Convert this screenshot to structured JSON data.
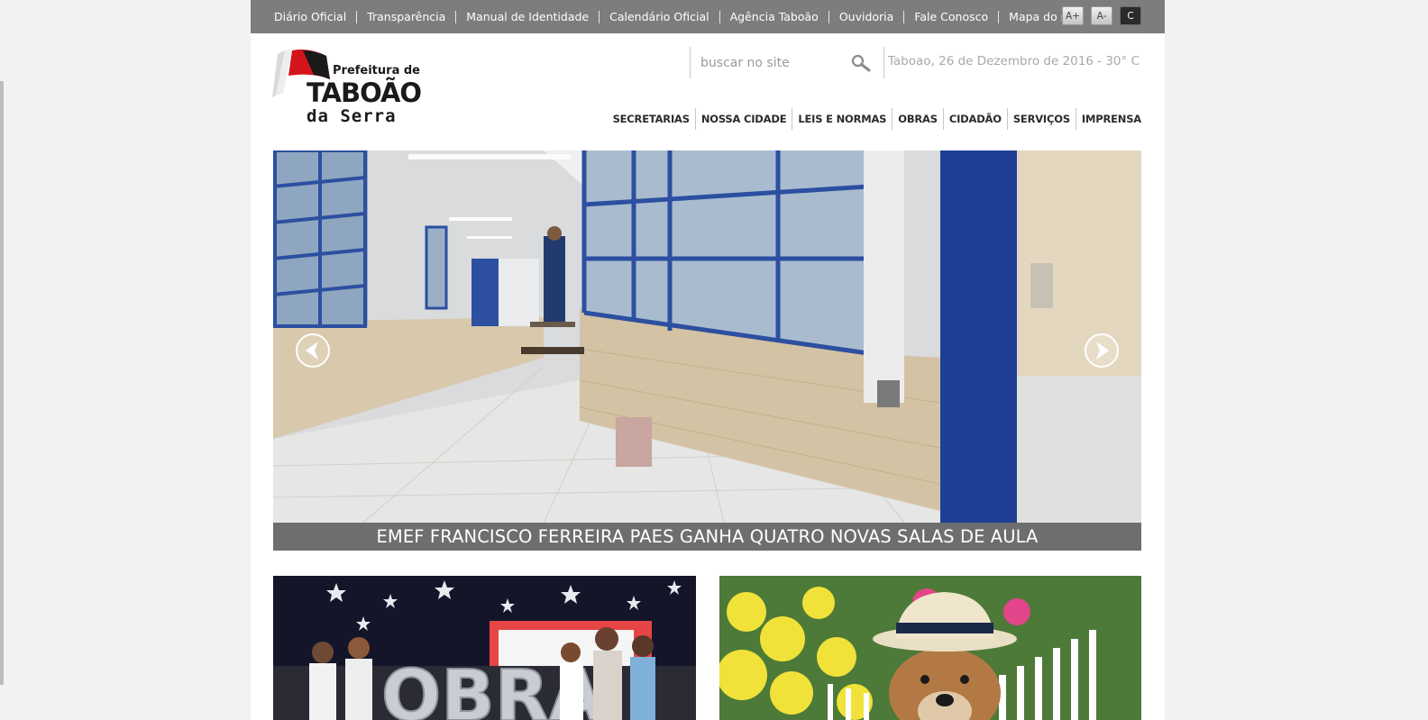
{
  "top_links": [
    "Diário Oficial",
    "Transparência",
    "Manual de Identidade",
    "Calendário Oficial",
    "Agência Taboão",
    "Ouvidoria",
    "Fale Conosco",
    "Mapa do site"
  ],
  "font_buttons": {
    "increase": "A+",
    "decrease": "A-",
    "contrast": "C"
  },
  "logo": {
    "line1": "Prefeitura de",
    "line2": "TABOÃO",
    "line3": "da Serra"
  },
  "search": {
    "placeholder": "buscar no site"
  },
  "date_weather": "Taboao, 26 de Dezembro de 2016 - 30° C",
  "main_nav": [
    "SECRETARIAS",
    "NOSSA CIDADE",
    "LEIS E NORMAS",
    "OBRAS",
    "CIDADÃO",
    "SERVIÇOS",
    "IMPRENSA"
  ],
  "slider": {
    "caption": "EMEF FRANCISCO FERREIRA PAES GANHA QUATRO NOVAS SALAS DE AULA"
  },
  "thumb_1": {
    "balloon_letters": "OBRA"
  },
  "colors": {
    "topbar": "#7c7d7e",
    "caption_bg": "#6d6e70",
    "logo_red": "#d4141b",
    "logo_black": "#1a1a1a",
    "window_blue": "#2c4fa0"
  }
}
